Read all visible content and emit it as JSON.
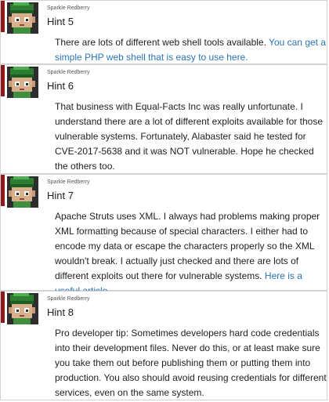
{
  "posts": [
    {
      "author": "Sparkle Redberry",
      "title": "Hint 5",
      "body": "There are lots of different web shell tools available. ",
      "link_text": "You can get a simple PHP web shell that is easy to use here.",
      "body_after": ""
    },
    {
      "author": "Sparkle Redberry",
      "title": "Hint 6",
      "body": "That business with Equal-Facts Inc was really unfortunate. I understand there are a lot of different exploits available for those vulnerable systems. Fortunately, Alabaster said he tested for CVE-2017-5638 and it was NOT vulnerable. Hope he checked the others too.",
      "link_text": "",
      "body_after": ""
    },
    {
      "author": "Sparkle Redberry",
      "title": "Hint 7",
      "body": "Apache Struts uses XML. I always had problems making proper XML formatting because of special characters. I either had to encode my data or escape the characters properly so the XML wouldn't break. I actually just checked and there are lots of different exploits out there for vulnerable systems. ",
      "link_text": "Here is a useful article.",
      "body_after": ""
    },
    {
      "author": "Sparkle Redberry",
      "title": "Hint 8",
      "body": "Pro developer tip: Sometimes developers hard code credentials into their development files. Never do this, or at least make sure you take them out before publishing them or putting them into production. You also should avoid reusing credentials for different services, even on the same system.",
      "link_text": "",
      "body_after": ""
    }
  ],
  "avatar_icon": "elf-avatar-icon",
  "colors": {
    "accent_bar": "#8e1a1a",
    "link": "#2b74b6",
    "hat": "#2f7d32",
    "border": "#d3d3d3"
  }
}
